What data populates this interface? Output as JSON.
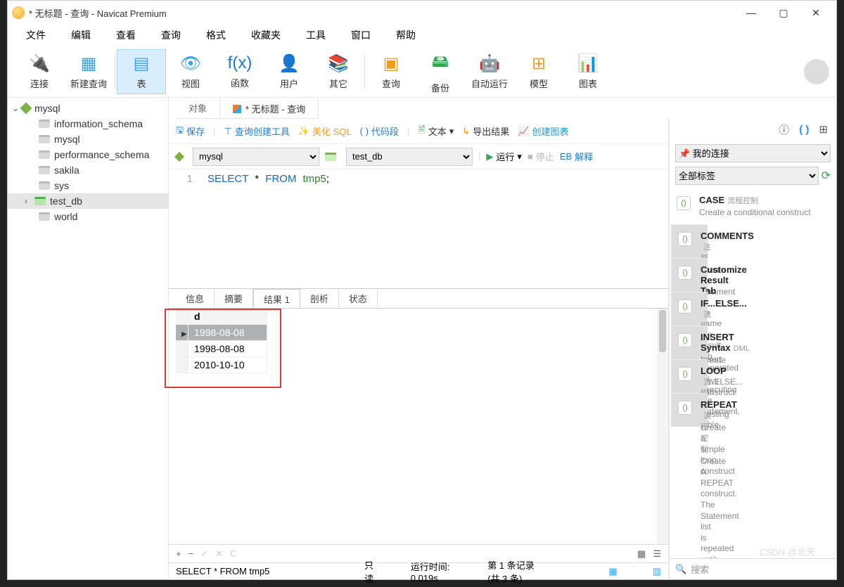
{
  "window": {
    "title": "* 无标题 - 查询 - Navicat Premium",
    "min": "—",
    "max": "▢",
    "close": "✕"
  },
  "menu": {
    "file": "文件",
    "edit": "编辑",
    "view": "查看",
    "query": "查询",
    "format": "格式",
    "fav": "收藏夹",
    "tools": "工具",
    "window": "窗口",
    "help": "帮助"
  },
  "toolbar": {
    "conn": "连接",
    "newq": "新建查询",
    "table": "表",
    "view": "视图",
    "func": "函数",
    "user": "用户",
    "other": "其它",
    "query": "查询",
    "backup": "备份",
    "auto": "自动运行",
    "model": "模型",
    "chart": "图表"
  },
  "tree": {
    "root": "mysql",
    "items": [
      "information_schema",
      "mysql",
      "performance_schema",
      "sakila",
      "sys",
      "test_db",
      "world"
    ]
  },
  "tabs": {
    "obj": "对象",
    "query": "* 无标题 - 查询"
  },
  "qtoolbar": {
    "save": "保存",
    "builder": "查询创建工具",
    "beautify": "美化 SQL",
    "snippet": "代码段",
    "text": "文本",
    "export": "导出结果",
    "chart": "创建图表"
  },
  "selrow": {
    "conn": "mysql",
    "db": "test_db",
    "run": "运行",
    "stop": "停止",
    "explain": "解释"
  },
  "sql": {
    "select": "SELECT",
    "star": "*",
    "from": "FROM",
    "table": "tmp5",
    "semi": ";"
  },
  "rtabs": {
    "info": "信息",
    "summary": "摘要",
    "result": "结果 1",
    "profile": "剖析",
    "status": "状态"
  },
  "grid": {
    "col": "d",
    "rows": [
      "1998-08-08",
      "1998-08-08",
      "2010-10-10"
    ]
  },
  "footer": {
    "plus": "+",
    "minus": "−",
    "check": "✓",
    "x": "✕",
    "c": "C"
  },
  "status": {
    "sql": "SELECT * FROM tmp5",
    "ro": "只读",
    "time": "运行时间: 0.019s",
    "rec": "第 1 条记录 (共 3 条)"
  },
  "rp_sel": {
    "conn": "我的连接",
    "tags": "全部标签"
  },
  "snippets": [
    {
      "t": "CASE",
      "sub": "流程控制",
      "d": "Create a conditional construct"
    },
    {
      "t": "COMMENTS",
      "sub": "注释",
      "d": "Create a comment"
    },
    {
      "t": "Customize Result Tab I",
      "sub": "",
      "d": "To name the result tab generated by executing the statement."
    },
    {
      "t": "IF...ELSE...",
      "sub": "流程控制",
      "d": "Create a IF...ELSE... construct"
    },
    {
      "t": "INSERT Syntax",
      "sub": "DML",
      "d": "Insert new rows into an existing table"
    },
    {
      "t": "LOOP",
      "sub": "流程控制",
      "d": "Create a simple loop construct"
    },
    {
      "t": "REPEAT",
      "sub": "流程控制",
      "d": "Create A REPEAT construct. The Statement list is repeated until the search_condition expression is true."
    }
  ],
  "rp_search": "搜索",
  "watermark": "CSDN @北天"
}
